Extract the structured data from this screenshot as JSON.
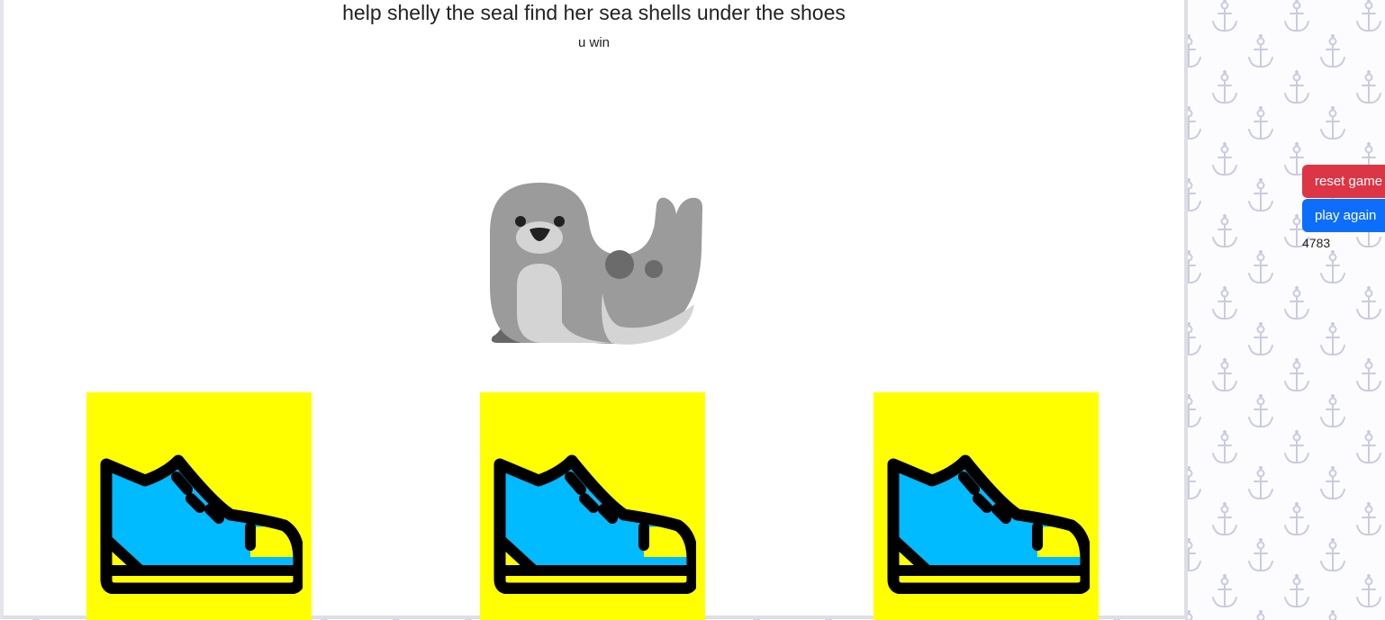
{
  "game": {
    "title": "help shelly the seal find her sea shells under the shoes",
    "status": "u win"
  },
  "shoes": [
    {
      "name": "shoe-1"
    },
    {
      "name": "shoe-2"
    },
    {
      "name": "shoe-3"
    }
  ],
  "controls": {
    "reset_label": "reset game",
    "play_again_label": "play again",
    "counter": "4783"
  },
  "colors": {
    "tile_yellow": "#ffff00",
    "shoe_blue": "#00bbff",
    "reset_red": "#dc3545",
    "play_blue": "#0d6efd"
  }
}
